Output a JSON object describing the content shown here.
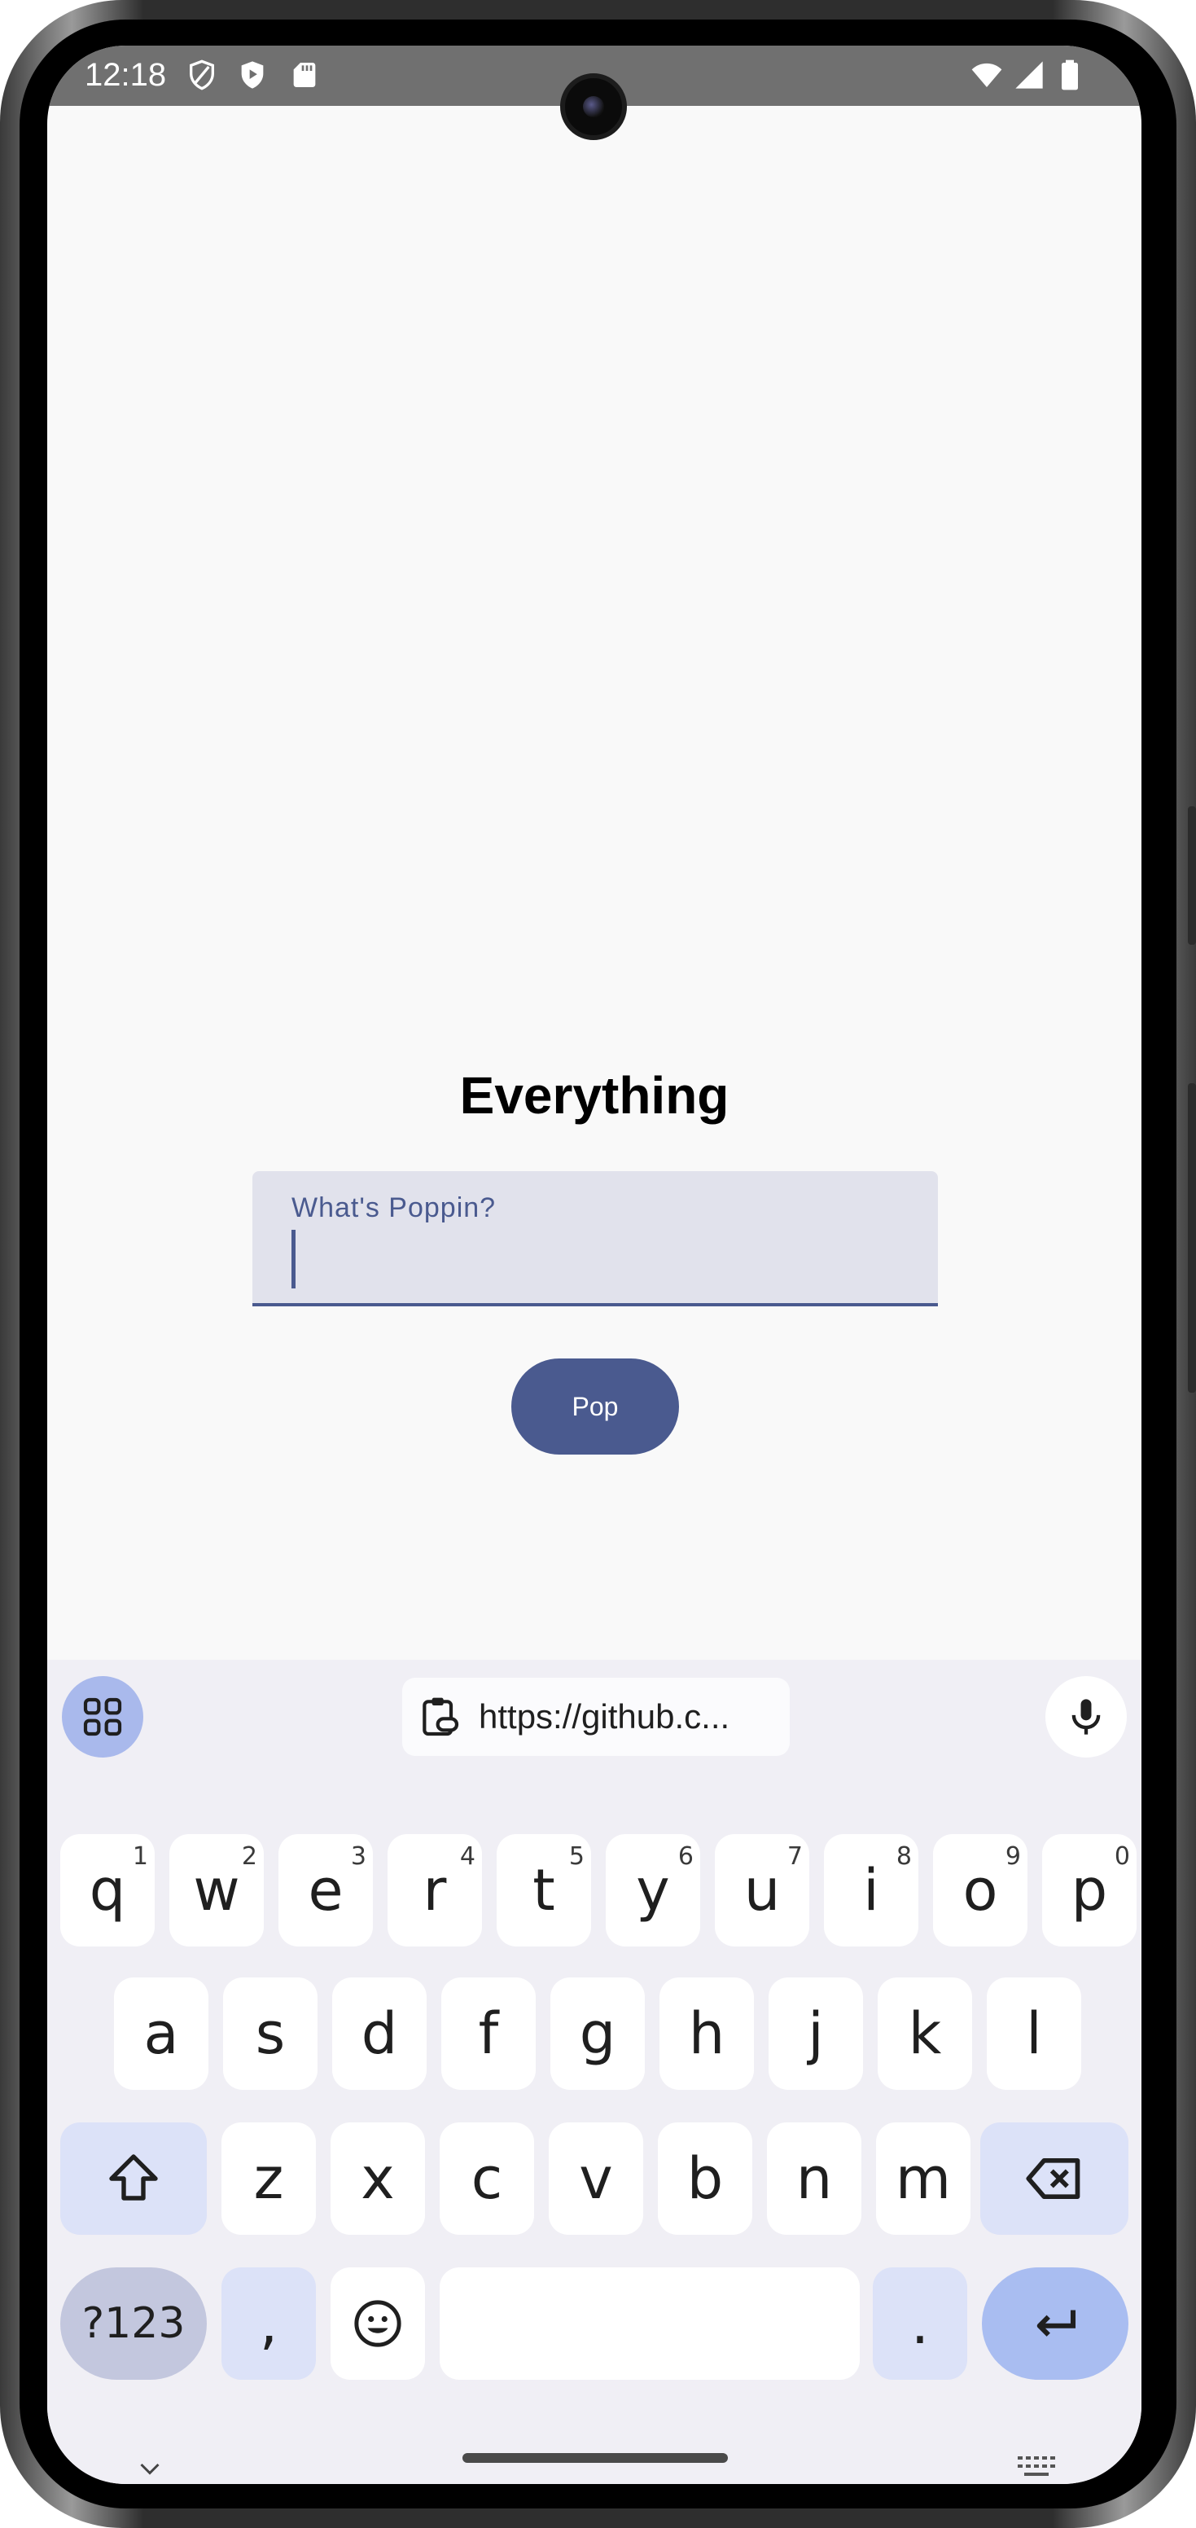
{
  "status_bar": {
    "time": "12:18",
    "left_icons": [
      "shield-outline-icon",
      "play-shield-icon",
      "sd-card-icon"
    ],
    "right_icons": [
      "wifi-icon",
      "signal-icon",
      "battery-icon"
    ]
  },
  "app": {
    "title": "Everything",
    "input": {
      "label": "What's Poppin?",
      "value": ""
    },
    "pop_button_label": "Pop",
    "colors": {
      "primary": "#4a5a8f",
      "field_bg": "#e1e2ec",
      "background": "#f9f9f9"
    }
  },
  "keyboard": {
    "clipboard_suggestion": "https://github.c...",
    "row1": [
      {
        "k": "q",
        "h": "1"
      },
      {
        "k": "w",
        "h": "2"
      },
      {
        "k": "e",
        "h": "3"
      },
      {
        "k": "r",
        "h": "4"
      },
      {
        "k": "t",
        "h": "5"
      },
      {
        "k": "y",
        "h": "6"
      },
      {
        "k": "u",
        "h": "7"
      },
      {
        "k": "i",
        "h": "8"
      },
      {
        "k": "o",
        "h": "9"
      },
      {
        "k": "p",
        "h": "0"
      }
    ],
    "row2": [
      "a",
      "s",
      "d",
      "f",
      "g",
      "h",
      "j",
      "k",
      "l"
    ],
    "row3": [
      "z",
      "x",
      "c",
      "v",
      "b",
      "n",
      "m"
    ],
    "symbols_label": "?123",
    "comma_label": ",",
    "period_label": ".",
    "colors": {
      "background": "#f0eff5",
      "special_key": "#dce2f8",
      "enter_key": "#a9bdf1"
    }
  }
}
